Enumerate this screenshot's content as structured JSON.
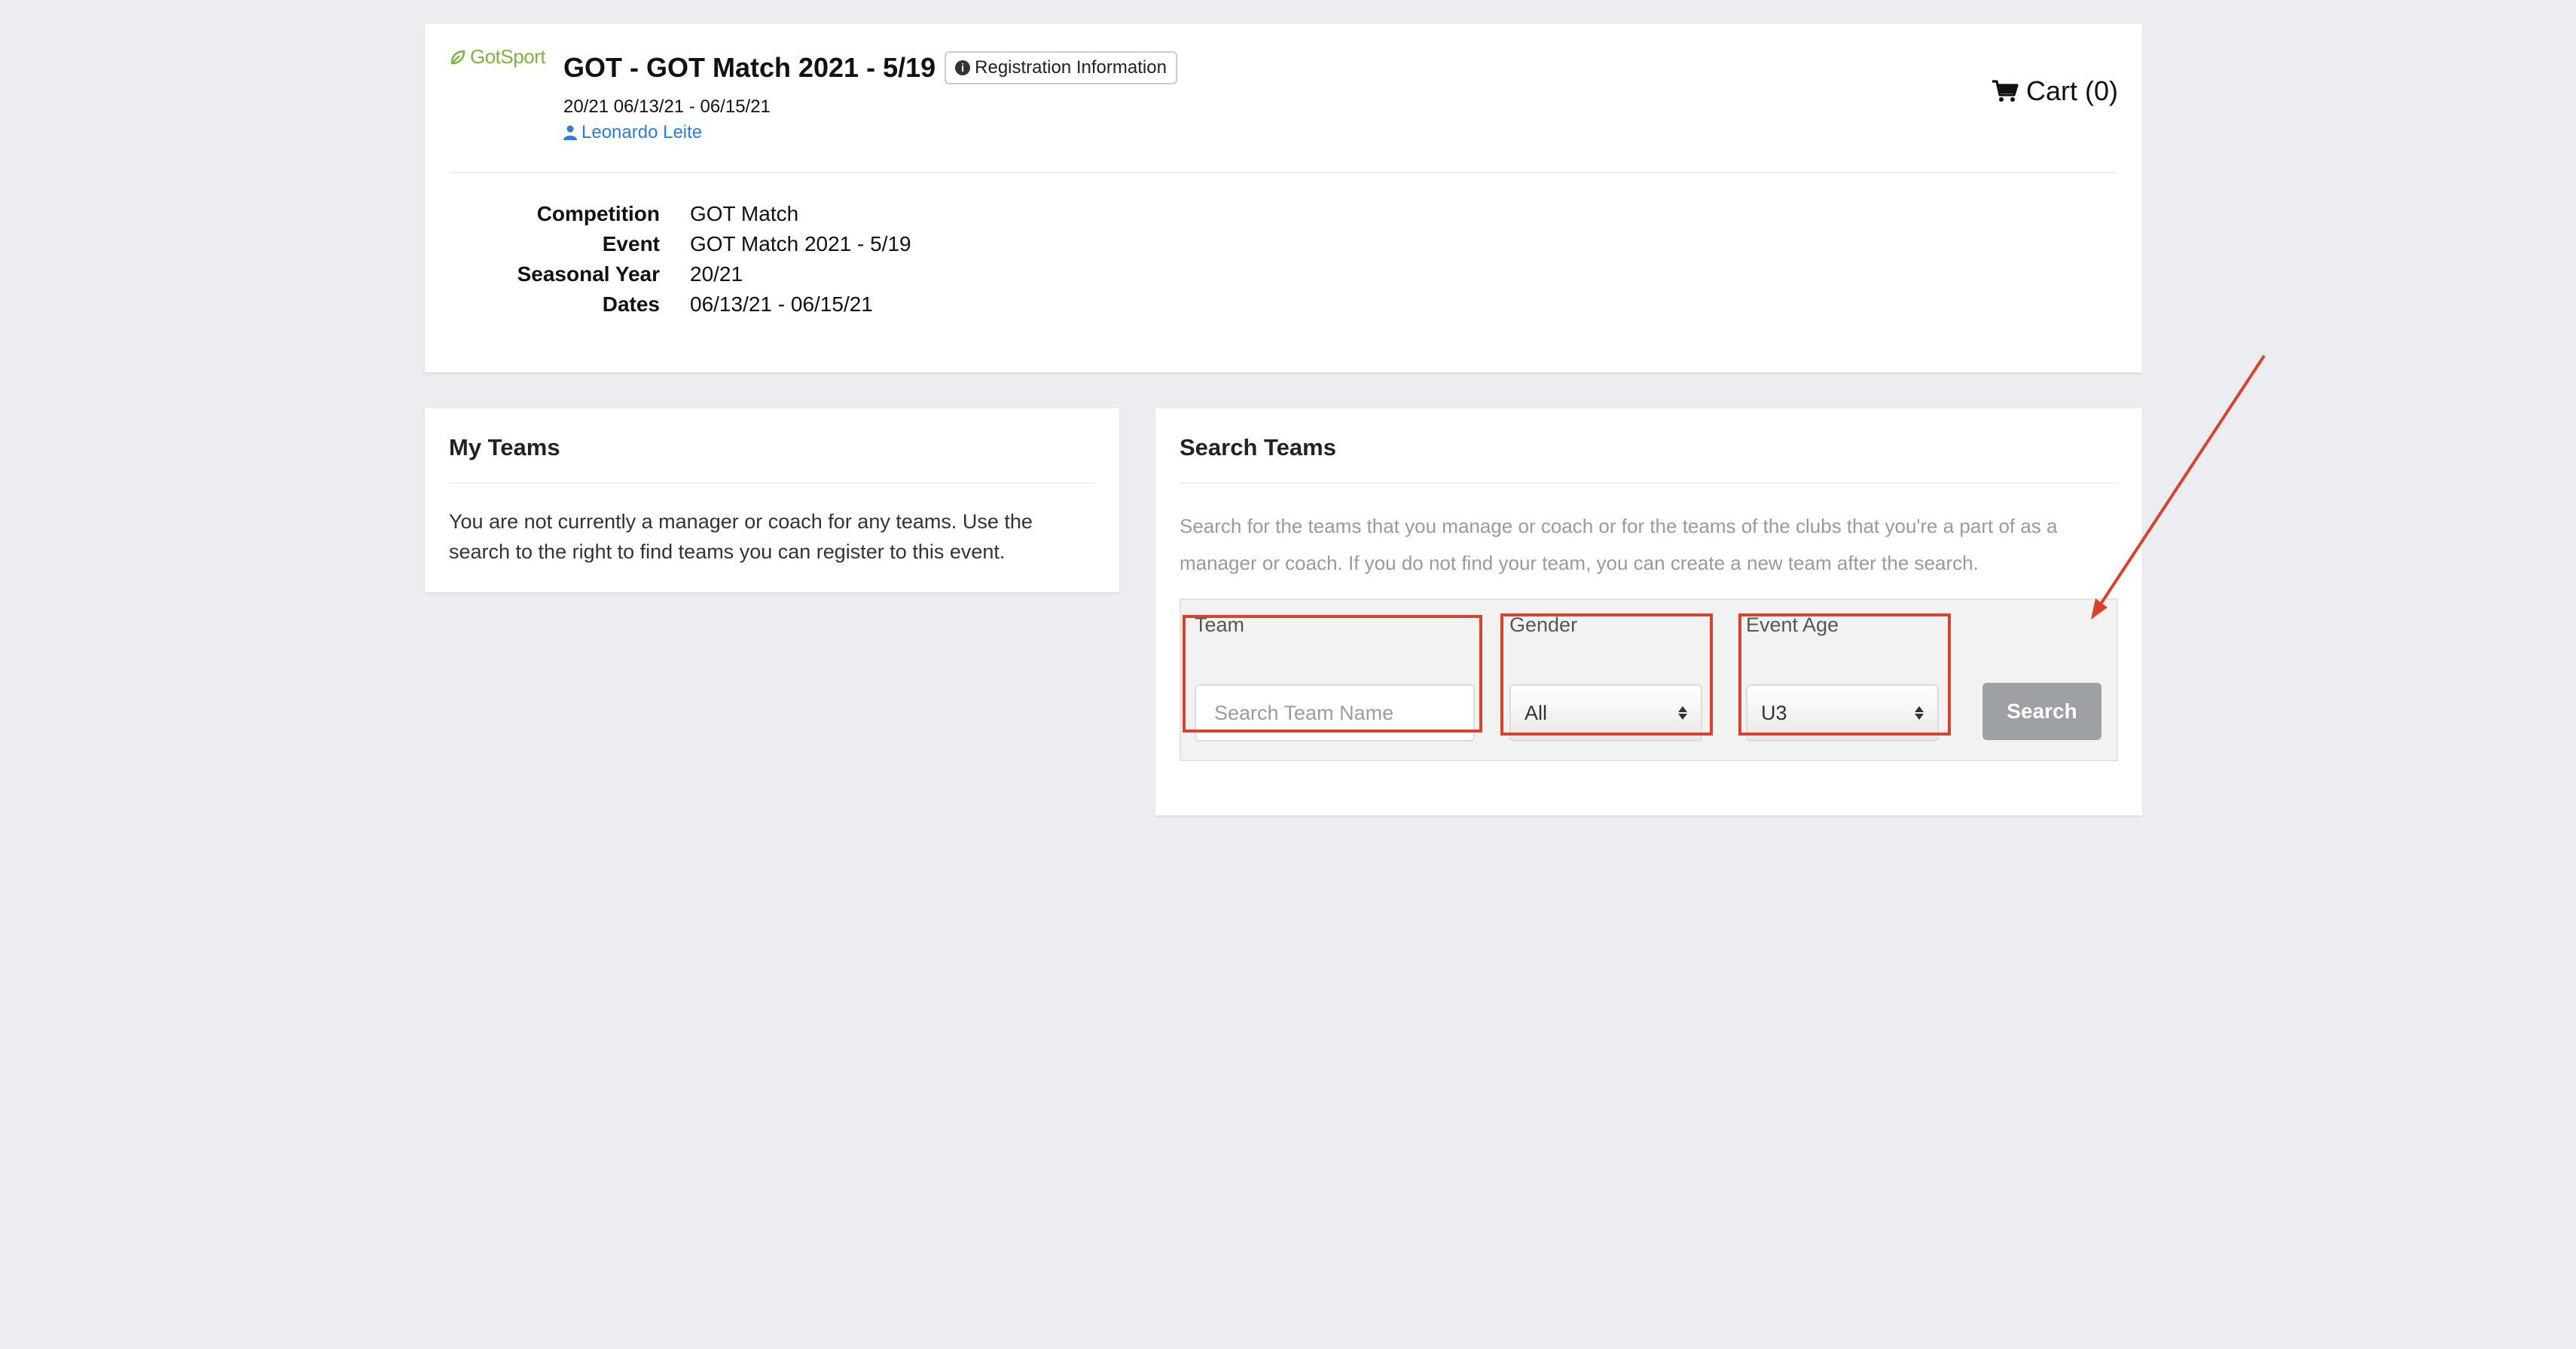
{
  "header": {
    "logo_text": "GotSport",
    "title": "GOT - GOT Match 2021 - 5/19",
    "registration_info_label": "Registration Information",
    "subtitle": "20/21 06/13/21 - 06/15/21",
    "organizer": "Leonardo Leite",
    "cart_label": "Cart (0)"
  },
  "event_details": [
    {
      "key": "Competition",
      "value": "GOT Match"
    },
    {
      "key": "Event",
      "value": "GOT Match 2021 - 5/19"
    },
    {
      "key": "Seasonal Year",
      "value": "20/21"
    },
    {
      "key": "Dates",
      "value": "06/13/21 - 06/15/21"
    }
  ],
  "my_teams": {
    "title": "My Teams",
    "message": "You are not currently a manager or coach for any teams. Use the search to the right to find teams you can register to this event."
  },
  "search_teams": {
    "title": "Search Teams",
    "description": "Search for the teams that you manage or coach or for the teams of the clubs that you're a part of as a manager or coach. If you do not find your team, you can create a new team after the search.",
    "team_label": "Team",
    "team_placeholder": "Search Team Name",
    "team_value": "",
    "gender_label": "Gender",
    "gender_value": "All",
    "age_label": "Event Age",
    "age_value": "U3",
    "search_button": "Search"
  },
  "colors": {
    "background": "#ecedf1",
    "link": "#2a7ed8",
    "logo_green": "#7cb342",
    "annotation_red": "#d9422c",
    "search_button": "#9da1a6"
  }
}
